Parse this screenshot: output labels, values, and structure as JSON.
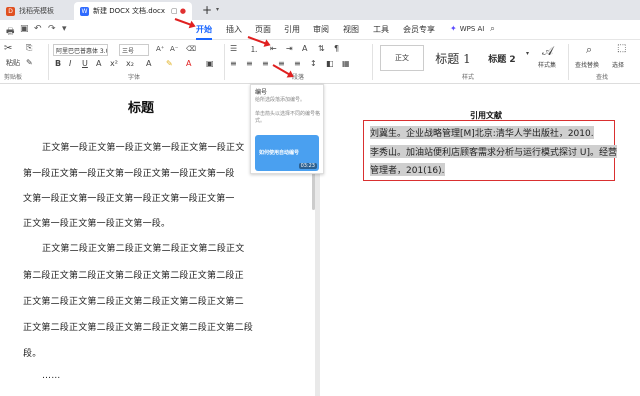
{
  "tabs": {
    "tab1": "找稻壳模板",
    "tab2": "新建 DOCX 文档.docx"
  },
  "menu": {
    "items": [
      "开始",
      "插入",
      "页面",
      "引用",
      "审阅",
      "视图",
      "工具",
      "会员专享"
    ],
    "wps_ai": "WPS AI"
  },
  "ribbon": {
    "clipboard_label": "剪贴板",
    "paste": "粘贴",
    "font_name": "阿里巴巴普惠体 3.0",
    "font_size": "三号",
    "font_label": "字体",
    "para_label": "段落",
    "style_body": "正文",
    "style_h1": "标题 1",
    "style_h2": "标题 2",
    "styles_label": "样式",
    "style_set": "样式集",
    "find_replace": "查找替换",
    "select": "选择",
    "find_label": "查找"
  },
  "popup": {
    "title": "编号",
    "desc1": "给所选段落添加编号。",
    "desc2": "单击箭头以选择不同的编号格式。",
    "video_title": "如何使用自动编号",
    "video_time": "03:23"
  },
  "document": {
    "title": "标题",
    "lines": [
      "正文第一段正文第一段正文第一段正文第一段正文",
      "第一段正文第一段正文第一段正文第一段正文第一段",
      "文第一段正文第一段正文第一段正文第一段正文第一",
      "正文第一段正文第一段正文第一段。",
      "正文第二段正文第二段正文第二段正文第二段正文",
      "第二段正文第二段正文第二段正文第二段正文第二段正",
      "正文第二段正文第二段正文第二段正文第二段正文第二",
      "正文第二段正文第二段正文第二段正文第二段正文第二段",
      "段。",
      "……"
    ]
  },
  "references": {
    "title": "引用文献",
    "lines": [
      "刘冀生。企业战略管理[M]北京:清华人学出版社，2010.",
      "李秀山。加油站便利店顾客需求分析与运行模式探讨 U]。经营",
      "管理者，201(16)."
    ]
  }
}
